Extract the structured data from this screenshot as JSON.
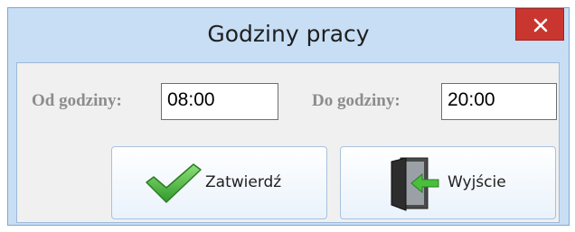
{
  "window": {
    "title": "Godziny pracy",
    "close_glyph": "×"
  },
  "form": {
    "from_label": "Od godziny:",
    "from_value": "08:00",
    "to_label": "Do godziny:",
    "to_value": "20:00"
  },
  "buttons": {
    "confirm_label": "Zatwierdź",
    "confirm_icon": "checkmark-icon",
    "exit_label": "Wyjście",
    "exit_icon": "exit-door-icon"
  },
  "colors": {
    "frame": "#c7def5",
    "close": "#c9362f",
    "check": "#3fb23a"
  }
}
